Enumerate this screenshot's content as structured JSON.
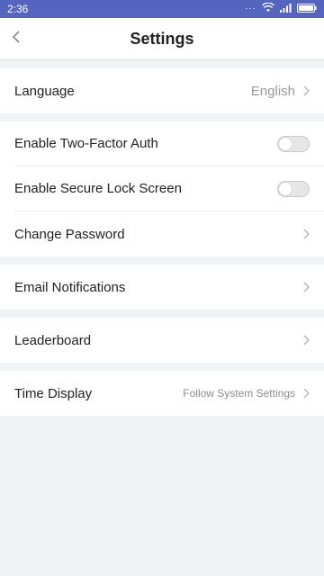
{
  "status_bar": {
    "time": "2:36",
    "dots": "···"
  },
  "header": {
    "title": "Settings"
  },
  "groups": {
    "language": {
      "label": "Language",
      "value": "English"
    },
    "security": {
      "two_factor": {
        "label": "Enable Two-Factor Auth",
        "enabled": false
      },
      "secure_lock": {
        "label": "Enable Secure Lock Screen",
        "enabled": false
      },
      "change_password": {
        "label": "Change Password"
      }
    },
    "email": {
      "label": "Email Notifications"
    },
    "leaderboard": {
      "label": "Leaderboard"
    },
    "time_display": {
      "label": "Time Display",
      "value": "Follow System Settings"
    }
  },
  "colors": {
    "status_bar": "#5564bf",
    "background": "#f1f2f4"
  }
}
